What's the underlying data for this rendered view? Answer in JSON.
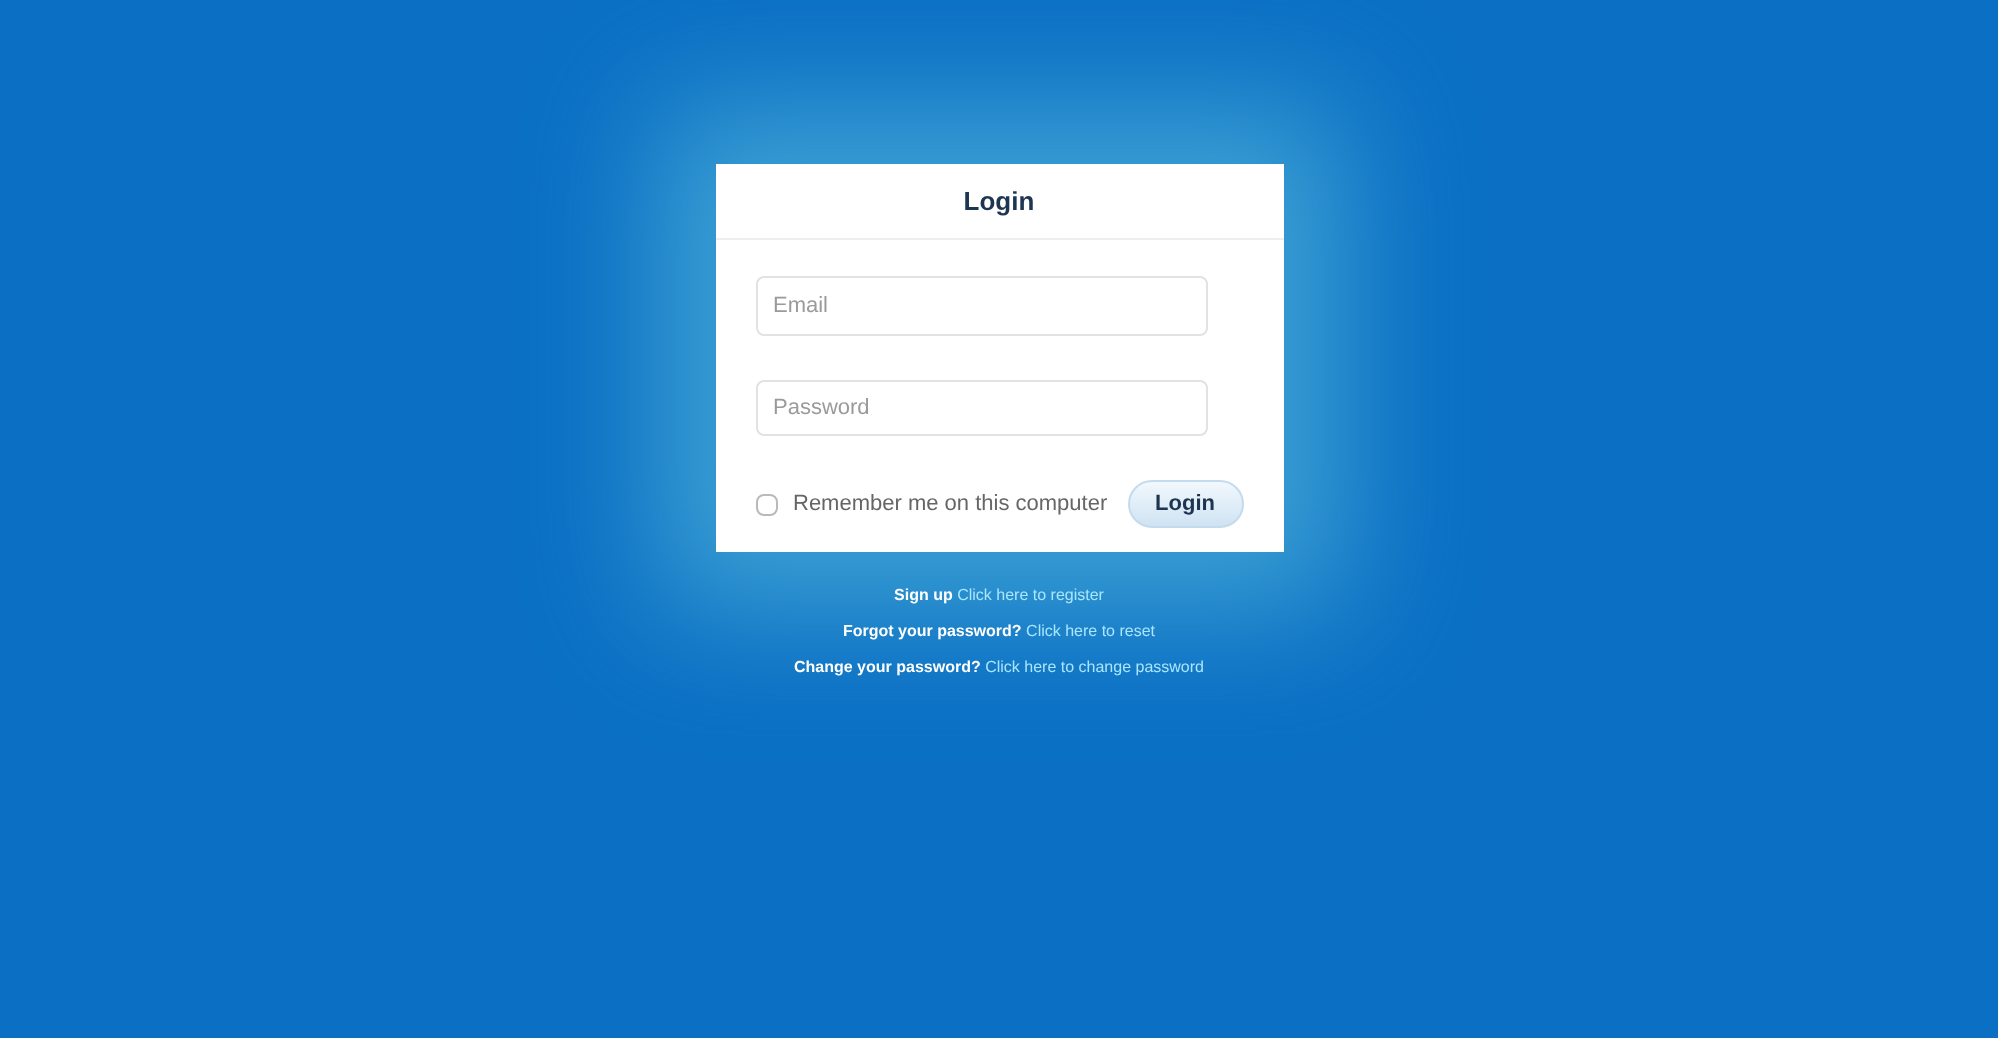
{
  "dialog": {
    "title": "Login",
    "email": {
      "placeholder": "Email"
    },
    "password": {
      "placeholder": "Password"
    },
    "remember": {
      "label": "Remember me on this computer",
      "checked": false
    },
    "submit": "Login"
  },
  "help_links": [
    {
      "lead": "Sign up",
      "link": "Click here to register"
    },
    {
      "lead": "Forgot your password?",
      "link": "Click here to reset"
    },
    {
      "lead": "Change your password?",
      "link": "Click here to change password"
    }
  ]
}
